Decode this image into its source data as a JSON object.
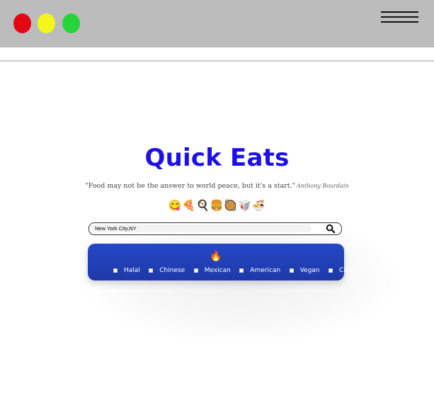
{
  "window_dots": [
    {
      "name": "red",
      "color": "#e30613"
    },
    {
      "name": "yellow",
      "color": "#f5f51d"
    },
    {
      "name": "green",
      "color": "#27d53a"
    }
  ],
  "menu_icon": "hamburger-menu-icon",
  "hero": {
    "title": "Quick Eats",
    "quote": "\"Food may not be the answer to world peace, but it's a start.\"",
    "author": "Anthony Bourdain",
    "emojis": "😋🍕🍳🍔🥘🥡🍜"
  },
  "search": {
    "value": "New York City,NY",
    "icon": "search-icon"
  },
  "filters": {
    "header_icon": "🔥",
    "items": [
      {
        "label": "Halal"
      },
      {
        "label": "Chinese"
      },
      {
        "label": "Mexican"
      },
      {
        "label": "American"
      },
      {
        "label": "Vegan"
      },
      {
        "label": "Cafes"
      }
    ]
  },
  "colors": {
    "title": "#1c10e6",
    "panel": "#2448c6",
    "topbar": "#bcbcbc"
  }
}
